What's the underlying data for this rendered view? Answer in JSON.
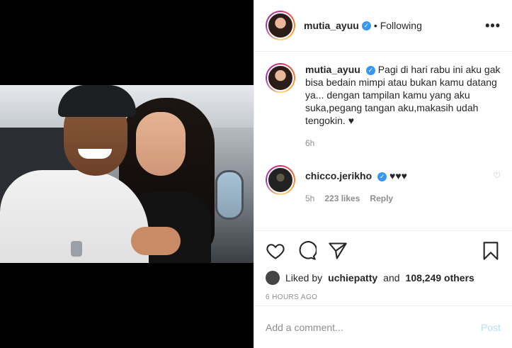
{
  "header": {
    "username": "mutia_ayuu",
    "follow_label": "Following",
    "separator": "•",
    "more_label": "•••"
  },
  "caption": {
    "username": "mutia_ayuu",
    "text": "Pagi di hari rabu ini aku gak bisa bedain mimpi atau bukan kamu datang ya... dengan tampilan kamu yang aku suka,pegang tangan aku,makasih udah tengokin. ♥",
    "time": "6h"
  },
  "comments": [
    {
      "username": "chicco.jerikho",
      "text": "♥♥♥",
      "time": "5h",
      "likes": "223 likes",
      "reply_label": "Reply"
    }
  ],
  "likes_line": {
    "prefix": "Liked by",
    "user": "uchiepatty",
    "and": "and",
    "others": "108,249 others"
  },
  "timestamp": "6 HOURS AGO",
  "add_comment": {
    "placeholder": "Add a comment...",
    "post_label": "Post"
  },
  "icons": [
    "heart-icon",
    "comment-icon",
    "share-icon",
    "bookmark-icon"
  ],
  "colors": {
    "verified": "#3897f0",
    "post_disabled": "#b2dffc",
    "muted": "#8e8e8e"
  }
}
